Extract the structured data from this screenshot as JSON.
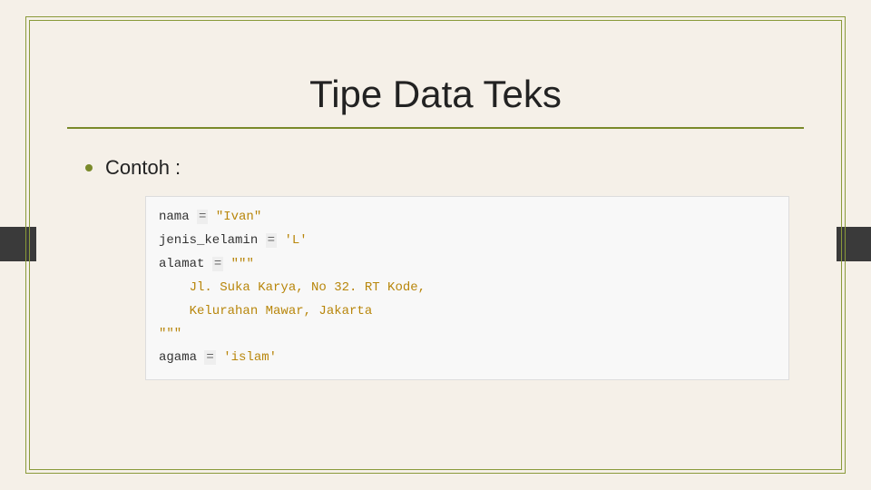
{
  "slide": {
    "title": "Tipe Data Teks",
    "bullet_label": "Contoh :",
    "code": {
      "l1_ident": "nama",
      "l1_op": "=",
      "l1_str": "\"Ivan\"",
      "l2_ident": "jenis_kelamin",
      "l2_op": "=",
      "l2_str": "'L'",
      "l3_ident": "alamat",
      "l3_op": "=",
      "l3_str": "\"\"\"",
      "l4_str": "    Jl. Suka Karya, No 32. RT Kode,",
      "l5_str": "    Kelurahan Mawar, Jakarta",
      "l6_str": "\"\"\"",
      "l7_ident": "agama",
      "l7_op": "=",
      "l7_str": "'islam'"
    }
  }
}
